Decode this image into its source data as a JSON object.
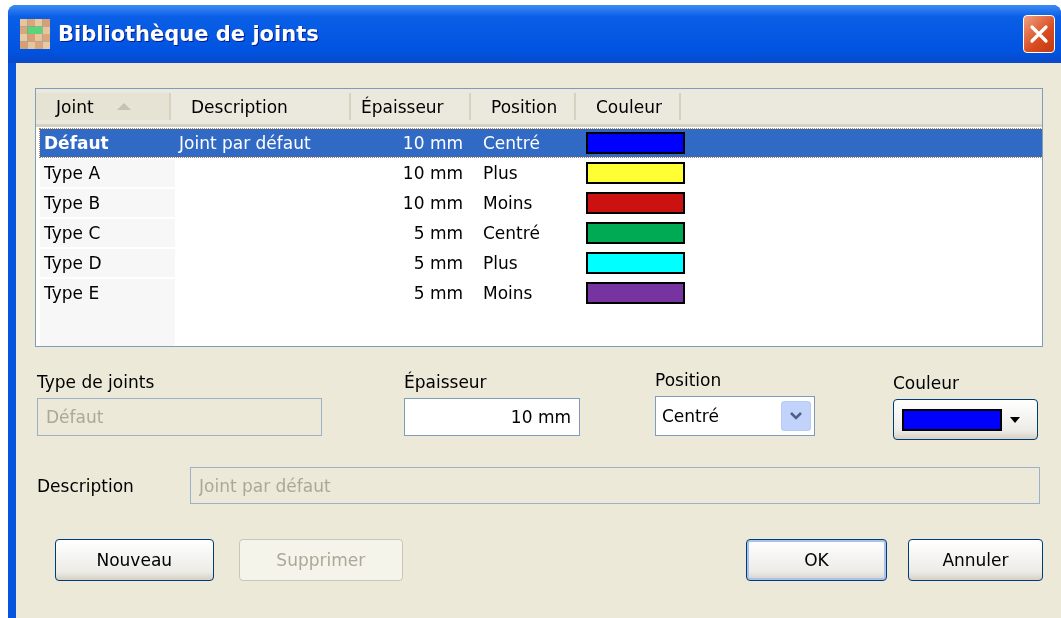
{
  "window": {
    "title": "Bibliothèque de joints"
  },
  "table": {
    "columns": [
      {
        "label": "Joint",
        "sorted": true
      },
      {
        "label": "Description",
        "sorted": false
      },
      {
        "label": "Épaisseur",
        "sorted": false
      },
      {
        "label": "Position",
        "sorted": false
      },
      {
        "label": "Couleur",
        "sorted": false
      }
    ],
    "rows": [
      {
        "joint": "Défaut",
        "description": "Joint par défaut",
        "thickness": "10 mm",
        "position": "Centré",
        "color": "#0000ff",
        "default": true,
        "selected": true
      },
      {
        "joint": "Type A",
        "thickness": "10 mm",
        "position": "Plus",
        "color": "#ffff33",
        "default": false,
        "selected": false
      },
      {
        "joint": "Type B",
        "thickness": "10 mm",
        "position": "Moins",
        "color": "#cc1111",
        "default": false,
        "selected": false
      },
      {
        "joint": "Type C",
        "thickness": "5 mm",
        "position": "Centré",
        "color": "#00aa55",
        "default": false,
        "selected": false
      },
      {
        "joint": "Type D",
        "thickness": "5 mm",
        "position": "Plus",
        "color": "#00ffff",
        "default": false,
        "selected": false
      },
      {
        "joint": "Type E",
        "thickness": "5 mm",
        "position": "Moins",
        "color": "#7733a0",
        "default": false,
        "selected": false
      }
    ]
  },
  "form": {
    "type": {
      "label": "Type de joints",
      "value": "Défaut",
      "disabled": true
    },
    "thickness": {
      "label": "Épaisseur",
      "value": "10 mm",
      "disabled": false
    },
    "position": {
      "label": "Position",
      "value": "Centré"
    },
    "color": {
      "label": "Couleur",
      "color": "#0000ff"
    },
    "description": {
      "label": "Description",
      "value": "Joint par défaut",
      "disabled": true
    }
  },
  "buttons": [
    {
      "label": "Nouveau",
      "disabled": false,
      "default": false
    },
    {
      "label": "Supprimer",
      "disabled": true,
      "default": false
    },
    {
      "label": "OK",
      "disabled": false,
      "default": true
    },
    {
      "label": "Annuler",
      "disabled": false,
      "default": false
    }
  ]
}
